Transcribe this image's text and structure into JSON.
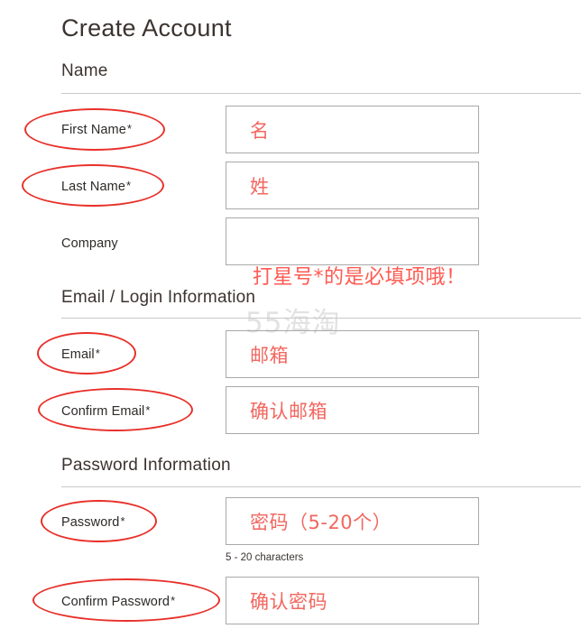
{
  "page": {
    "title": "Create Account",
    "watermark": "55海淘",
    "annotation_note": "打星号*的是必填项哦！",
    "accent_red": "#e8302a",
    "value_red": "#f2675f",
    "text_color": "#3c3330",
    "rule_color": "#c9c9c9",
    "box_border_color": "#a9a9a9"
  },
  "sections": [
    {
      "id": "name",
      "header": "Name",
      "fields": [
        {
          "id": "first-name",
          "label": "First Name",
          "required": true,
          "required_marker": "*",
          "value": "名",
          "circled": true,
          "hint": ""
        },
        {
          "id": "last-name",
          "label": "Last Name",
          "required": true,
          "required_marker": "*",
          "value": "姓",
          "circled": true,
          "hint": ""
        },
        {
          "id": "company",
          "label": "Company",
          "required": false,
          "required_marker": "",
          "value": "",
          "circled": false,
          "hint": ""
        }
      ]
    },
    {
      "id": "email-login",
      "header": "Email / Login Information",
      "fields": [
        {
          "id": "email",
          "label": "Email",
          "required": true,
          "required_marker": "*",
          "value": "邮箱",
          "circled": true,
          "hint": ""
        },
        {
          "id": "confirm-email",
          "label": "Confirm Email",
          "required": true,
          "required_marker": "*",
          "value": "确认邮箱",
          "circled": true,
          "hint": ""
        }
      ]
    },
    {
      "id": "password",
      "header": "Password Information",
      "fields": [
        {
          "id": "password",
          "label": "Password",
          "required": true,
          "required_marker": "*",
          "value": "密码（5-20个）",
          "circled": true,
          "hint": "5 - 20 characters"
        },
        {
          "id": "confirm-password",
          "label": "Confirm Password",
          "required": true,
          "required_marker": "*",
          "value": "确认密码",
          "circled": true,
          "hint": ""
        }
      ]
    }
  ]
}
